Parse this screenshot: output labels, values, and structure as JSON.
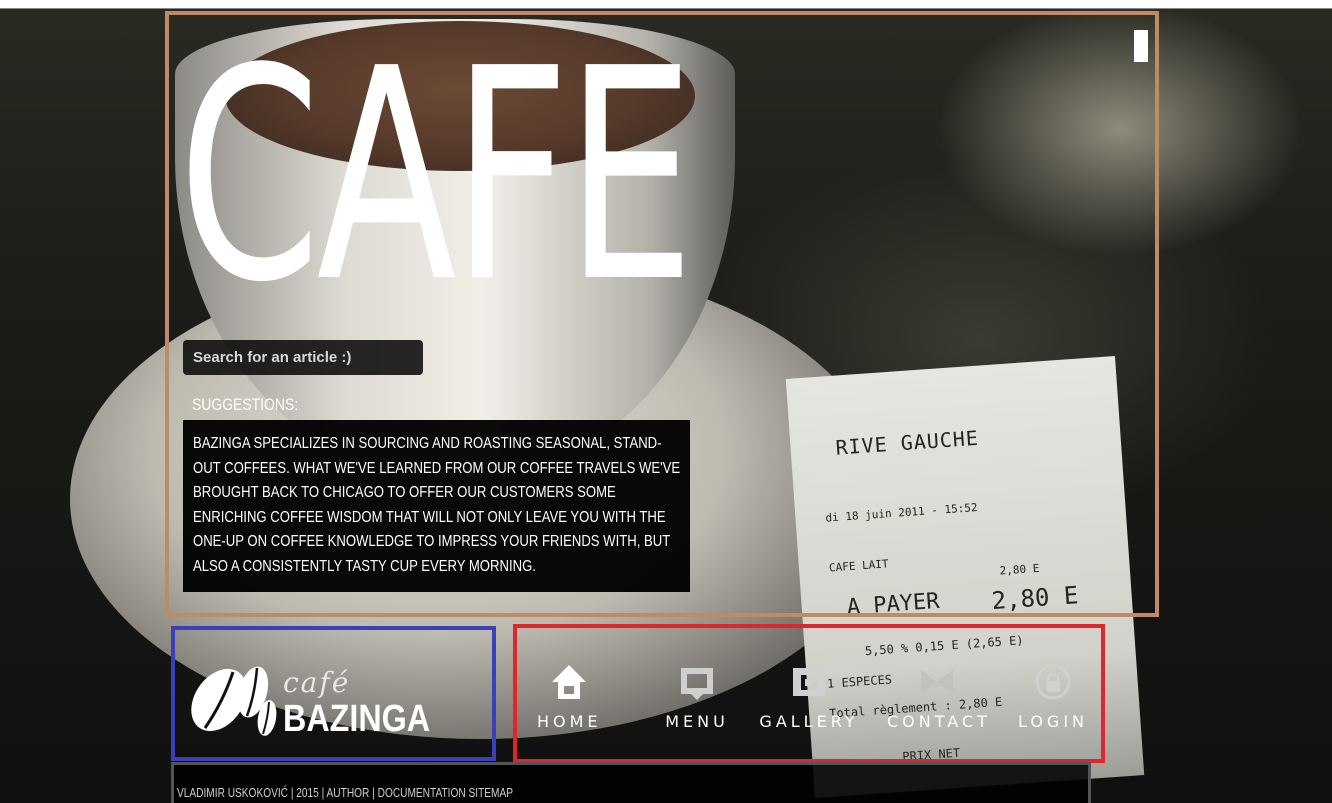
{
  "hero": {
    "title": "CAFE",
    "search_placeholder": "Search for an article :)",
    "suggestions_label": "SUGGESTIONS:",
    "suggestions_text": "BAZINGA SPECIALIZES IN SOURCING AND ROASTING SEASONAL, STAND-OUT COFFEES. WHAT WE'VE LEARNED FROM OUR COFFEE TRAVELS WE'VE BROUGHT BACK TO CHICAGO TO OFFER OUR CUSTOMERS SOME ENRICHING COFFEE WISDOM THAT WILL NOT ONLY LEAVE YOU WITH THE ONE-UP ON COFFEE KNOWLEDGE TO IMPRESS YOUR FRIENDS WITH, BUT ALSO A CONSISTENTLY TASTY CUP EVERY MORNING."
  },
  "logo": {
    "cafe": "café",
    "bazinga": "BAZINGA"
  },
  "nav": {
    "items": [
      {
        "label": "HOME",
        "icon": "home-icon"
      },
      {
        "label": "MENU",
        "icon": "menu-icon"
      },
      {
        "label": "GALLERY",
        "icon": "gallery-icon"
      },
      {
        "label": "CONTACT",
        "icon": "contact-icon"
      },
      {
        "label": "LOGIN",
        "icon": "lock-icon"
      }
    ]
  },
  "footer": {
    "text": "VLADIMIR USKOKOVIĆ | 2015 | AUTHOR | DOCUMENTATION SITEMAP"
  },
  "receipt": {
    "title": "RIVE GAUCHE",
    "date": "di 18 juin 2011 - 15:52",
    "item": "CAFE LAIT",
    "item_price": "2,80 E",
    "pay_label": "A PAYER",
    "pay_total": "2,80 E",
    "tva": "5,50 %    0,15 E    (2,65 E)",
    "especes": "1  ESPECES",
    "reglement": "Total règlement : 2,80 E",
    "prix_net": "PRIX NET"
  },
  "colors": {
    "hero_border": "#c08a66",
    "logo_border": "#3b3fb8",
    "nav_border": "#e0262d"
  }
}
